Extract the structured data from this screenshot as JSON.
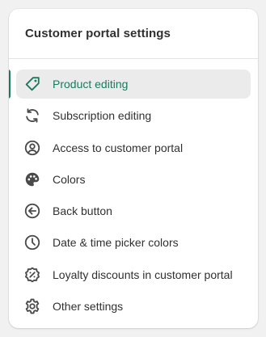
{
  "card": {
    "title": "Customer portal settings"
  },
  "nav": {
    "active_index": 0,
    "items": [
      {
        "label": "Product editing",
        "icon": "tag-icon"
      },
      {
        "label": "Subscription editing",
        "icon": "refresh-icon"
      },
      {
        "label": "Access to customer portal",
        "icon": "user-circle-icon"
      },
      {
        "label": "Colors",
        "icon": "palette-icon"
      },
      {
        "label": "Back button",
        "icon": "arrow-left-circle-icon"
      },
      {
        "label": "Date & time picker colors",
        "icon": "clock-icon"
      },
      {
        "label": "Loyalty discounts in customer portal",
        "icon": "discount-icon"
      },
      {
        "label": "Other settings",
        "icon": "gear-icon"
      }
    ]
  },
  "colors": {
    "accent": "#1a7a5e",
    "active_background": "#ebebeb",
    "text": "#303030",
    "icon": "#4a4a4a"
  }
}
